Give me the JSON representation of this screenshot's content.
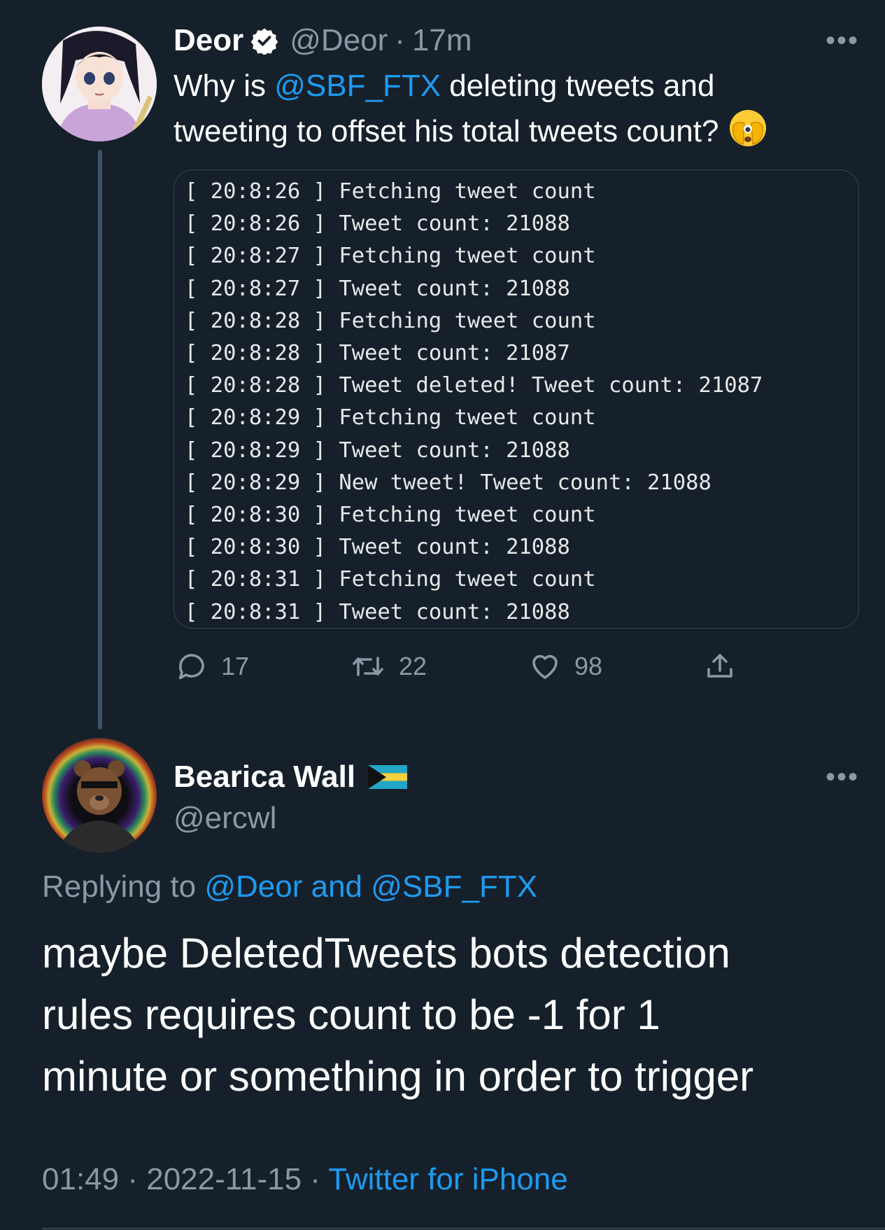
{
  "original_tweet": {
    "author_name": "Deor",
    "verified_icon": "verified-badge-icon",
    "handle": "@Deor",
    "separator": "·",
    "time_ago": "17m",
    "text_part1": "Why is ",
    "mention": "@SBF_FTX",
    "text_part2": " deleting tweets and",
    "text_line2": "tweeting to offset his total tweets count?",
    "emoji": "🫣",
    "terminal_lines": [
      "[ 20:8:26 ] Fetching tweet count",
      "[ 20:8:26 ] Tweet count: 21088",
      "[ 20:8:27 ] Fetching tweet count",
      "[ 20:8:27 ] Tweet count: 21088",
      "[ 20:8:28 ] Fetching tweet count",
      "[ 20:8:28 ] Tweet count: 21087",
      "[ 20:8:28 ] Tweet deleted! Tweet count: 21087",
      "[ 20:8:29 ] Fetching tweet count",
      "[ 20:8:29 ] Tweet count: 21088",
      "[ 20:8:29 ] New tweet! Tweet count: 21088",
      "[ 20:8:30 ] Fetching tweet count",
      "[ 20:8:30 ] Tweet count: 21088",
      "[ 20:8:31 ] Fetching tweet count",
      "[ 20:8:31 ] Tweet count: 21088"
    ],
    "actions": {
      "replies": "17",
      "retweets": "22",
      "likes": "98"
    }
  },
  "reply_tweet": {
    "author_name": "Bearica Wall",
    "flag_icon": "bahamas-flag-icon",
    "handle": "@ercwl",
    "replying_prefix": "Replying to ",
    "replying_targets": "@Deor and @SBF_FTX",
    "body_lines": [
      "maybe DeletedTweets bots detection",
      "rules requires count to be -1 for 1",
      "minute or something in order to trigger"
    ],
    "time": "01:49",
    "separator": "·",
    "date": "2022-11-15",
    "client": "Twitter for iPhone"
  },
  "more_label": "•••",
  "colors": {
    "background": "#15202b",
    "link": "#1d9bf0",
    "muted": "#8b98a5",
    "border": "#38444d"
  }
}
